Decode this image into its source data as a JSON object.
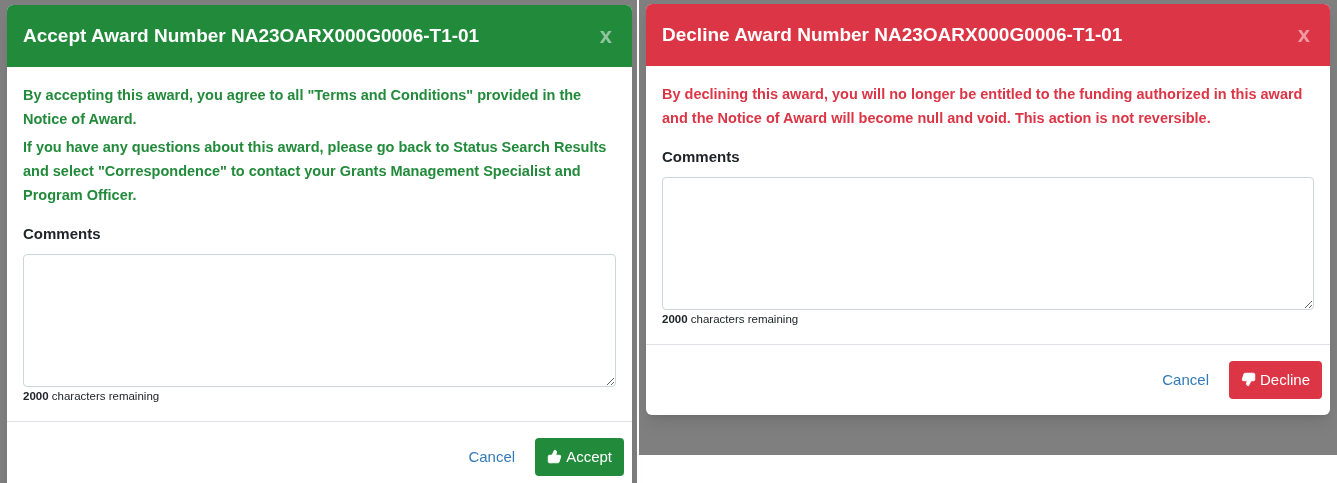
{
  "dialogs": [
    {
      "kind": "accept",
      "title": "Accept Award Number NA23OARX000G0006-T1-01",
      "close": "x",
      "messages": [
        "By accepting this award, you agree to all \"Terms and Conditions\" provided in the Notice of Award.",
        "If you have any questions about this award, please go back to Status Search Results and select  \"Correspondence\" to contact your Grants Management Specialist and Program Officer."
      ],
      "comments_label": "Comments",
      "remaining": "**2000** characters remaining",
      "cancel": "Cancel",
      "action": "Accept"
    },
    {
      "kind": "decline",
      "title": "Decline Award Number NA23OARX000G0006-T1-01",
      "close": "x",
      "messages": [
        "By declining this award, you will no longer be entitled to the funding authorized in this award and  the Notice of Award will become null and void. This action is not reversible."
      ],
      "comments_label": "Comments",
      "remaining": "**2000** characters remaining",
      "cancel": "Cancel",
      "action": "Decline"
    }
  ]
}
